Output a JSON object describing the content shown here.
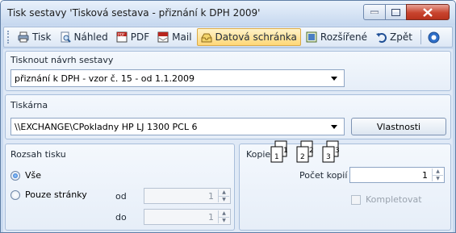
{
  "window": {
    "title": "Tisk sestavy 'Tisková sestava - přiznání k DPH 2009'",
    "controls": {
      "minimize": "–",
      "maximize": "□",
      "close": "✕"
    }
  },
  "toolbar": {
    "items": [
      {
        "label": "Tisk",
        "icon": "printer-icon"
      },
      {
        "label": "Náhled",
        "icon": "preview-icon"
      },
      {
        "label": "PDF",
        "icon": "pdf-icon"
      },
      {
        "label": "Mail",
        "icon": "mail-pdf-icon"
      },
      {
        "label": "Datová schránka",
        "icon": "databox-icon",
        "active": true
      },
      {
        "label": "Rozšířené",
        "icon": "extended-icon"
      },
      {
        "label": "Zpět",
        "icon": "undo-icon"
      }
    ],
    "help_icon": "help-icon"
  },
  "report": {
    "label": "Tisknout návrh sestavy",
    "value": "přiznání k DPH - vzor č. 15 - od 1.1.2009"
  },
  "printer": {
    "label": "Tiskárna",
    "value": "\\\\EXCHANGE\\CPokladny HP LJ 1300 PCL 6",
    "properties_button": "Vlastnosti"
  },
  "range": {
    "label": "Rozsah tisku",
    "all_label": "Vše",
    "pages_label": "Pouze stránky",
    "from_label": "od",
    "to_label": "do",
    "from_value": "1",
    "to_value": "1"
  },
  "copies": {
    "label": "Kopie",
    "count_label": "Počet kopií",
    "count_value": "1",
    "collate_label": "Kompletovat",
    "collate_checked": false,
    "page_numbers": [
      "1",
      "1",
      "2",
      "2",
      "3",
      "3"
    ]
  },
  "colors": {
    "accent": "#1b5fc4",
    "active_highlight": "#ffd777",
    "close_button": "#c8442e"
  }
}
